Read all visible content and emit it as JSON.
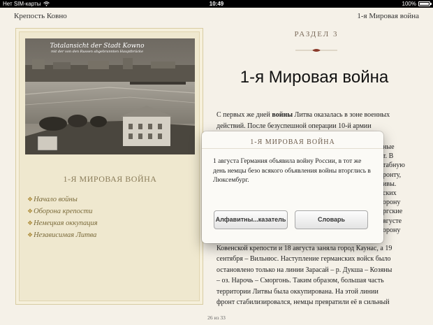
{
  "status_bar": {
    "carrier": "Нет SIM-карты",
    "time": "10:49",
    "battery_pct": "100%",
    "battery_level": 1.0
  },
  "header": {
    "book_title": "Крепость Ковно",
    "chapter_title": "1-я Мировая война"
  },
  "left_panel": {
    "photo_caption_line1": "Totalansicht der Stadt Kowno",
    "photo_caption_line2": "mit der von den Russen abgebrannten Hauptbrücke",
    "title": "1-Я МИРОВАЯ ВОЙНА",
    "toc": [
      {
        "bullet": "❖",
        "label": "Начало войны"
      },
      {
        "bullet": "❖",
        "label": "Оборона крепости"
      },
      {
        "bullet": "❖",
        "label": "Немецкая оккупация"
      },
      {
        "bullet": "❖",
        "label": "Независимая Литва"
      }
    ]
  },
  "main": {
    "section_label": "РАЗДЕЛ 3",
    "title": "1-я Мировая война",
    "para_intro": "С первых же дней ",
    "para_bold": "войны",
    "para_rest": " Литва оказалась в зоне военных действий. После безуспешной операции 10-й армии",
    "bottom_lines": [
      "Ковенской крепости и 18 августа заняла город Каунас, а 19",
      "сентября – Вильнюс. Наступление германских войск было",
      "остановлено только на линии Зарасай – р. Дукша – Козяны",
      "– оз. Нарочь – Сморгонь. Таким образом, большая часть",
      "территории Литвы была оккупирована. На этой линии",
      "фронт стабилизировался, немцы превратили её в сильный"
    ],
    "right_fragments": [
      "ные",
      "т. В",
      "табную",
      "ронту,",
      "ивы.",
      "ских",
      "орону",
      "ргские",
      "вгусте",
      "орону"
    ]
  },
  "popover": {
    "title": "1-Я МИРОВАЯ ВОЙНА",
    "text": "1 августа Германия объявила войну России, в тот же день немцы безо всякого объявления войны вторглись в Люксембург.",
    "button_index": "Алфавитны...казатель",
    "button_dictionary": "Словарь"
  },
  "footer": {
    "page_indicator": "26 из 33"
  }
}
